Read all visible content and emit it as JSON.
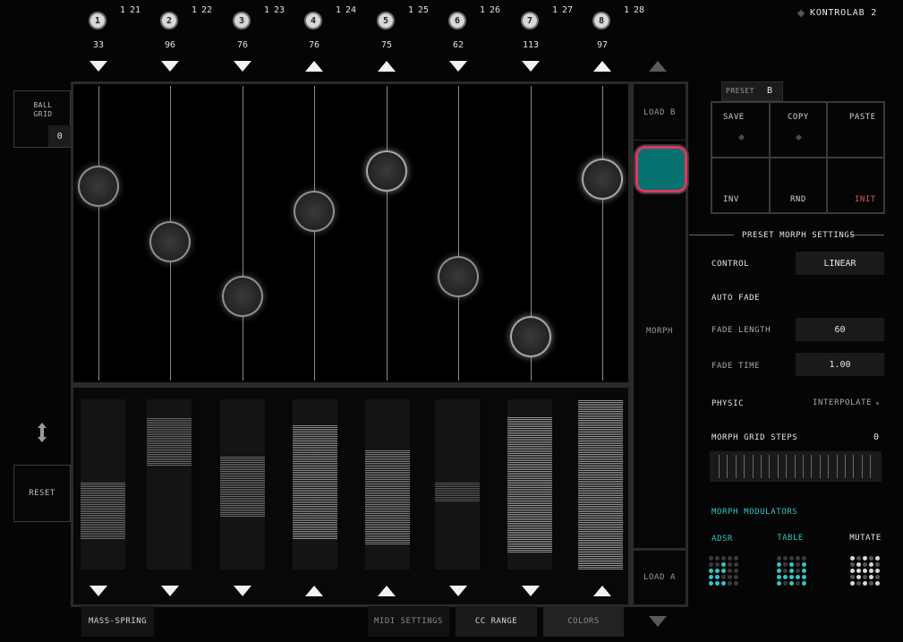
{
  "app": {
    "title": "KONTROLAB 2"
  },
  "channels": [
    {
      "num": "1",
      "cc_prefix": "1",
      "cc": "21",
      "value": "33",
      "dir": "down",
      "ball": 0.7,
      "bar_top": 0.51,
      "bar_bottom": 0.18,
      "bar_dir": "down"
    },
    {
      "num": "2",
      "cc_prefix": "1",
      "cc": "22",
      "value": "96",
      "dir": "down",
      "ball": 0.48,
      "bar_top": 0.89,
      "bar_bottom": 0.61,
      "bar_dir": "down"
    },
    {
      "num": "3",
      "cc_prefix": "1",
      "cc": "23",
      "value": "76",
      "dir": "down",
      "ball": 0.26,
      "bar_top": 0.67,
      "bar_bottom": 0.31,
      "bar_dir": "down"
    },
    {
      "num": "4",
      "cc_prefix": "1",
      "cc": "24",
      "value": "76",
      "dir": "up",
      "ball": 0.6,
      "bar_top": 0.85,
      "bar_bottom": 0.18,
      "bar_dir": "up"
    },
    {
      "num": "5",
      "cc_prefix": "1",
      "cc": "25",
      "value": "75",
      "dir": "up",
      "ball": 0.76,
      "bar_top": 0.7,
      "bar_bottom": 0.15,
      "bar_dir": "up"
    },
    {
      "num": "6",
      "cc_prefix": "1",
      "cc": "26",
      "value": "62",
      "dir": "down",
      "ball": 0.34,
      "bar_top": 0.51,
      "bar_bottom": 0.4,
      "bar_dir": "down"
    },
    {
      "num": "7",
      "cc_prefix": "1",
      "cc": "27",
      "value": "113",
      "dir": "down",
      "ball": 0.1,
      "bar_top": 0.9,
      "bar_bottom": 0.1,
      "bar_dir": "down"
    },
    {
      "num": "8",
      "cc_prefix": "1",
      "cc": "28",
      "value": "97",
      "dir": "up",
      "ball": 0.73,
      "bar_top": 1.0,
      "bar_bottom": 0.0,
      "bar_dir": "up"
    }
  ],
  "left": {
    "ball_grid_label_1": "BALL",
    "ball_grid_label_2": "GRID",
    "ball_grid_value": "0",
    "reset_label": "RESET"
  },
  "morph": {
    "load_b": "LOAD B",
    "morph_label": "MORPH",
    "load_a": "LOAD A",
    "position": 0.0
  },
  "preset": {
    "label": "PRESET",
    "value": "B",
    "save": "SAVE",
    "copy": "COPY",
    "paste": "PASTE",
    "inv": "INV",
    "rnd": "RND",
    "init": "INIT"
  },
  "morph_settings": {
    "heading": "PRESET MORPH SETTINGS",
    "control_label": "CONTROL",
    "control_value": "LINEAR",
    "auto_fade_label": "AUTO FADE",
    "fade_length_label": "FADE LENGTH",
    "fade_length_value": "60",
    "fade_time_label": "FADE TIME",
    "fade_time_value": "1.00",
    "physic_label": "PHYSIC",
    "physic_value": "INTERPOLATE",
    "grid_steps_label": "MORPH GRID STEPS",
    "grid_steps_value": "0"
  },
  "modulators": {
    "heading": "MORPH MODULATORS",
    "adsr": "ADSR",
    "table": "TABLE",
    "mutate": "MUTATE"
  },
  "bottom_tabs": {
    "mass_spring": "MASS-SPRING",
    "midi_settings": "MIDI SETTINGS",
    "cc_range": "CC RANGE",
    "colors": "COLORS"
  },
  "colors": {
    "accent_teal": "#07716f",
    "accent_pink": "#e0375f",
    "init_red": "#e05a5a",
    "modulator_cyan": "#2fc6c6"
  }
}
